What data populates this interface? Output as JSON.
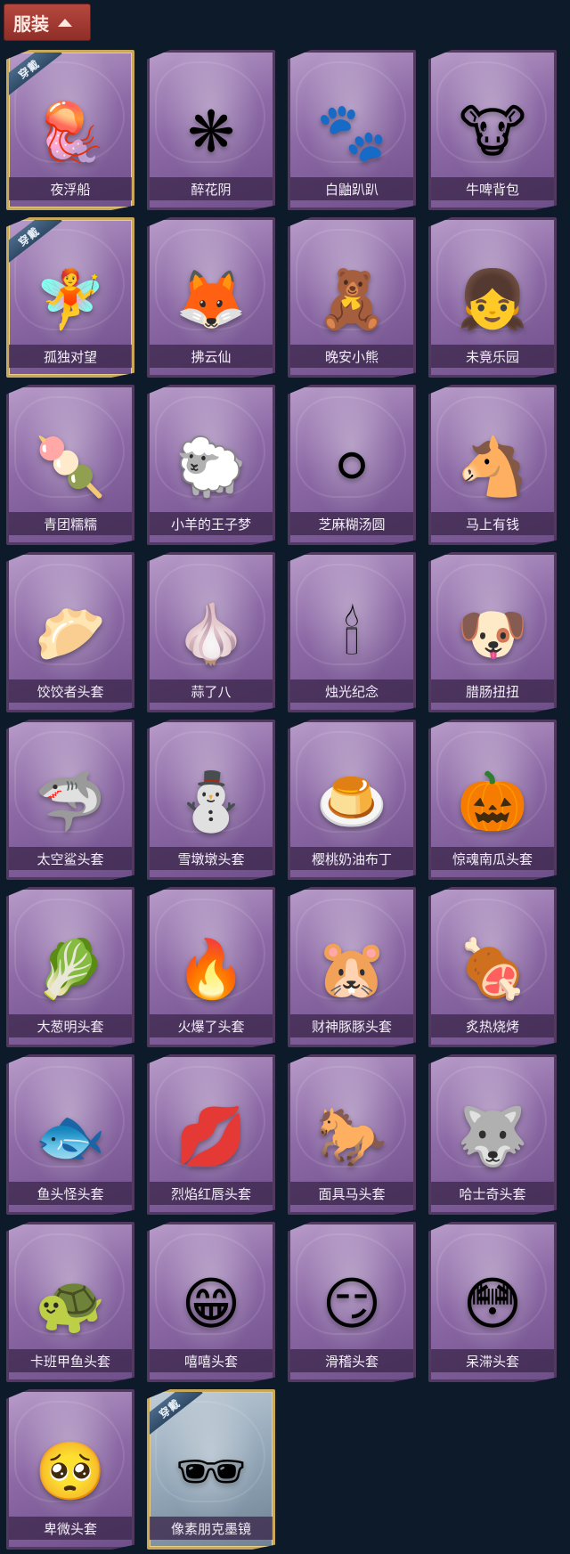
{
  "header": {
    "label": "服装"
  },
  "badge_text": "穿戴",
  "items": [
    {
      "name": "夜浮船",
      "icon": "jellyfish-icon",
      "glyph": "🪼",
      "equipped": true,
      "style": "purple"
    },
    {
      "name": "醉花阴",
      "icon": "dreamcatcher-icon",
      "glyph": "❋",
      "equipped": false,
      "style": "purple"
    },
    {
      "name": "白鼬趴趴",
      "icon": "ferret-plush-icon",
      "glyph": "🐾",
      "equipped": false,
      "style": "purple"
    },
    {
      "name": "牛啤背包",
      "icon": "cow-barrel-icon",
      "glyph": "🐮",
      "equipped": false,
      "style": "purple"
    },
    {
      "name": "孤独对望",
      "icon": "fairy-doll-icon",
      "glyph": "🧚",
      "equipped": true,
      "style": "purple"
    },
    {
      "name": "拂云仙",
      "icon": "charm-pendant-icon",
      "glyph": "🦊",
      "equipped": false,
      "style": "purple"
    },
    {
      "name": "晚安小熊",
      "icon": "teddy-bear-icon",
      "glyph": "🧸",
      "equipped": false,
      "style": "purple"
    },
    {
      "name": "未竟乐园",
      "icon": "girl-doll-icon",
      "glyph": "👧",
      "equipped": false,
      "style": "purple"
    },
    {
      "name": "青团糯糯",
      "icon": "green-dumpling-icon",
      "glyph": "🍡",
      "equipped": false,
      "style": "purple"
    },
    {
      "name": "小羊的王子梦",
      "icon": "sheep-crown-icon",
      "glyph": "🐑",
      "equipped": false,
      "style": "purple"
    },
    {
      "name": "芝麻糊汤圆",
      "icon": "rice-ball-icon",
      "glyph": "⚪",
      "equipped": false,
      "style": "purple"
    },
    {
      "name": "马上有钱",
      "icon": "horse-head-icon",
      "glyph": "🐴",
      "equipped": false,
      "style": "purple"
    },
    {
      "name": "饺饺者头套",
      "icon": "dumpling-head-icon",
      "glyph": "🥟",
      "equipped": false,
      "style": "purple"
    },
    {
      "name": "蒜了八",
      "icon": "garlic-head-icon",
      "glyph": "🧄",
      "equipped": false,
      "style": "purple"
    },
    {
      "name": "烛光纪念",
      "icon": "candle-head-icon",
      "glyph": "🕯",
      "equipped": false,
      "style": "purple"
    },
    {
      "name": "腊肠扭扭",
      "icon": "dachshund-head-icon",
      "glyph": "🐶",
      "equipped": false,
      "style": "purple"
    },
    {
      "name": "太空鲨头套",
      "icon": "shark-head-icon",
      "glyph": "🦈",
      "equipped": false,
      "style": "purple"
    },
    {
      "name": "雪墩墩头套",
      "icon": "snowman-head-icon",
      "glyph": "⛄",
      "equipped": false,
      "style": "purple"
    },
    {
      "name": "樱桃奶油布丁",
      "icon": "pudding-head-icon",
      "glyph": "🍮",
      "equipped": false,
      "style": "purple"
    },
    {
      "name": "惊魂南瓜头套",
      "icon": "pumpkin-head-icon",
      "glyph": "🎃",
      "equipped": false,
      "style": "purple"
    },
    {
      "name": "大葱明头套",
      "icon": "scallion-head-icon",
      "glyph": "🥬",
      "equipped": false,
      "style": "purple"
    },
    {
      "name": "火爆了头套",
      "icon": "fire-head-icon",
      "glyph": "🔥",
      "equipped": false,
      "style": "purple"
    },
    {
      "name": "财神豚豚头套",
      "icon": "capybara-head-icon",
      "glyph": "🐹",
      "equipped": false,
      "style": "purple"
    },
    {
      "name": "炙热烧烤",
      "icon": "bbq-meat-head-icon",
      "glyph": "🍖",
      "equipped": false,
      "style": "purple"
    },
    {
      "name": "鱼头怪头套",
      "icon": "fish-head-icon",
      "glyph": "🐟",
      "equipped": false,
      "style": "purple"
    },
    {
      "name": "烈焰红唇头套",
      "icon": "pikachu-lips-head-icon",
      "glyph": "💋",
      "equipped": false,
      "style": "purple"
    },
    {
      "name": "面具马头套",
      "icon": "horse-mask-icon",
      "glyph": "🐎",
      "equipped": false,
      "style": "purple"
    },
    {
      "name": "哈士奇头套",
      "icon": "husky-head-icon",
      "glyph": "🐺",
      "equipped": false,
      "style": "purple"
    },
    {
      "name": "卡班甲鱼头套",
      "icon": "turtle-head-icon",
      "glyph": "🐢",
      "equipped": false,
      "style": "purple"
    },
    {
      "name": "嘻嘻头套",
      "icon": "grinning-emoji-icon",
      "glyph": "😁",
      "equipped": false,
      "style": "purple"
    },
    {
      "name": "滑稽头套",
      "icon": "smirk-emoji-icon",
      "glyph": "😏",
      "equipped": false,
      "style": "purple"
    },
    {
      "name": "呆滞头套",
      "icon": "dazed-emoji-icon",
      "glyph": "😳",
      "equipped": false,
      "style": "purple"
    },
    {
      "name": "卑微头套",
      "icon": "humble-emoji-icon",
      "glyph": "🥺",
      "equipped": false,
      "style": "purple"
    },
    {
      "name": "像素朋克墨镜",
      "icon": "pixel-sunglasses-icon",
      "glyph": "🕶",
      "equipped": true,
      "style": "grey"
    }
  ]
}
